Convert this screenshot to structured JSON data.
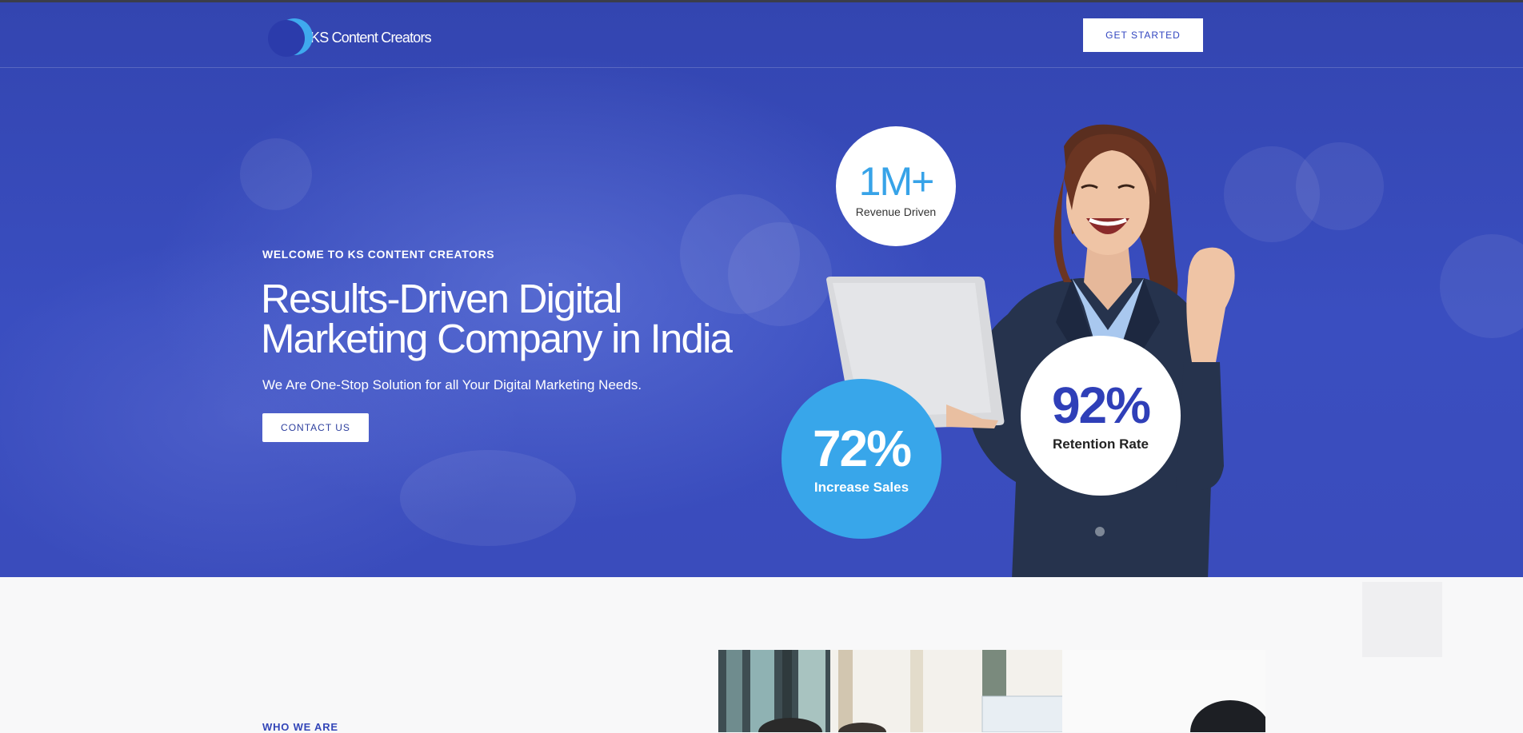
{
  "header": {
    "logo_text": "KS Content Creators",
    "cta_label": "GET STARTED"
  },
  "hero": {
    "kicker": "WELCOME TO KS CONTENT CREATORS",
    "headline": "Results-Driven Digital Marketing Company in India",
    "subline": "We Are One-Stop Solution for all Your Digital Marketing Needs.",
    "contact_label": "CONTACT US"
  },
  "stats": {
    "revenue": {
      "value": "1M+",
      "label": "Revenue Driven"
    },
    "sales": {
      "value": "72%",
      "label": "Increase Sales"
    },
    "retention": {
      "value": "92%",
      "label": "Retention Rate"
    }
  },
  "about": {
    "kicker": "WHO WE ARE"
  },
  "colors": {
    "hero_blue": "#3a4cbc",
    "accent_light_blue": "#38a6ea",
    "accent_dark_blue": "#2f3fb8"
  }
}
